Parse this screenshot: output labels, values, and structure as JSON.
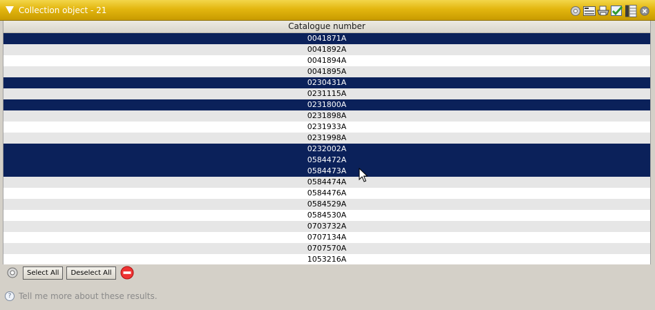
{
  "window": {
    "title": "Collection object - 21",
    "toolbar_icons": [
      "gear-icon",
      "form-view-icon",
      "print-icon",
      "edit-check-icon",
      "grid-view-icon",
      "close-icon"
    ]
  },
  "table": {
    "column_header": "Catalogue number",
    "rows": [
      {
        "value": "0041871A",
        "selected": true
      },
      {
        "value": "0041892A",
        "selected": false
      },
      {
        "value": "0041894A",
        "selected": false
      },
      {
        "value": "0041895A",
        "selected": false
      },
      {
        "value": "0230431A",
        "selected": true
      },
      {
        "value": "0231115A",
        "selected": false
      },
      {
        "value": "0231800A",
        "selected": true
      },
      {
        "value": "0231898A",
        "selected": false
      },
      {
        "value": "0231933A",
        "selected": false
      },
      {
        "value": "0231998A",
        "selected": false
      },
      {
        "value": "0232002A",
        "selected": true
      },
      {
        "value": "0584472A",
        "selected": true
      },
      {
        "value": "0584473A",
        "selected": true
      },
      {
        "value": "0584474A",
        "selected": false
      },
      {
        "value": "0584476A",
        "selected": false
      },
      {
        "value": "0584529A",
        "selected": false
      },
      {
        "value": "0584530A",
        "selected": false
      },
      {
        "value": "0703732A",
        "selected": false
      },
      {
        "value": "0707134A",
        "selected": false
      },
      {
        "value": "0707570A",
        "selected": false
      },
      {
        "value": "1053216A",
        "selected": false
      }
    ]
  },
  "actions": {
    "select_all": "Select All",
    "deselect_all": "Deselect All"
  },
  "help": {
    "icon": "?",
    "text": "Tell me more about these results."
  },
  "colors": {
    "title_bar": "#e3b60f",
    "selected_row": "#0b215a",
    "alt_row": "#e6e6e6"
  }
}
